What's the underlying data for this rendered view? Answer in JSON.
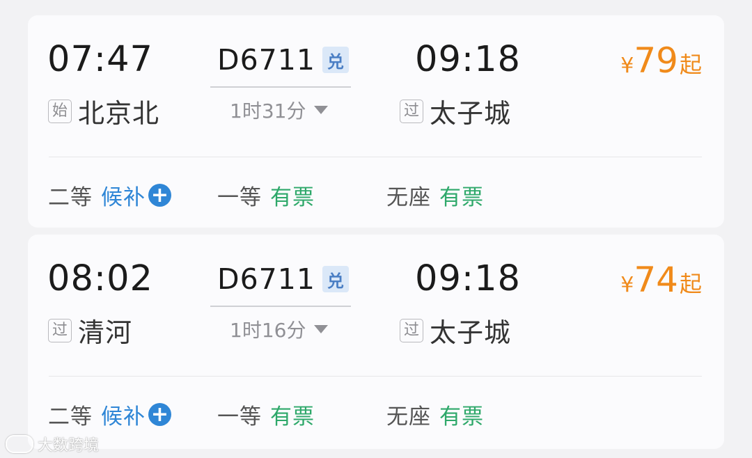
{
  "trains": [
    {
      "dep_time": "07:47",
      "dep_tag": "始",
      "dep_station": "北京北",
      "train_no": "D6711",
      "badge": "兑",
      "duration": "1时31分",
      "arr_time": "09:18",
      "arr_tag": "过",
      "arr_station": "太子城",
      "price": {
        "currency": "¥",
        "amount": "79",
        "suffix": "起"
      },
      "seats": [
        {
          "class": "二等",
          "status": "候补",
          "status_type": "waitlist",
          "has_plus": true
        },
        {
          "class": "一等",
          "status": "有票",
          "status_type": "available"
        },
        {
          "class": "无座",
          "status": "有票",
          "status_type": "available"
        }
      ]
    },
    {
      "dep_time": "08:02",
      "dep_tag": "过",
      "dep_station": "清河",
      "train_no": "D6711",
      "badge": "兑",
      "duration": "1时16分",
      "arr_time": "09:18",
      "arr_tag": "过",
      "arr_station": "太子城",
      "price": {
        "currency": "¥",
        "amount": "74",
        "suffix": "起"
      },
      "seats": [
        {
          "class": "二等",
          "status": "候补",
          "status_type": "waitlist",
          "has_plus": true
        },
        {
          "class": "一等",
          "status": "有票",
          "status_type": "available"
        },
        {
          "class": "无座",
          "status": "有票",
          "status_type": "available"
        }
      ]
    }
  ],
  "colors": {
    "price": "#f08a1a",
    "available": "#2ea86a",
    "waitlist": "#2f86d6",
    "badge_bg": "#dbe8f8"
  },
  "icons": {
    "plus": "plus-circle-icon",
    "caret": "caret-down-icon"
  },
  "watermark": {
    "text": "大数跨境"
  }
}
